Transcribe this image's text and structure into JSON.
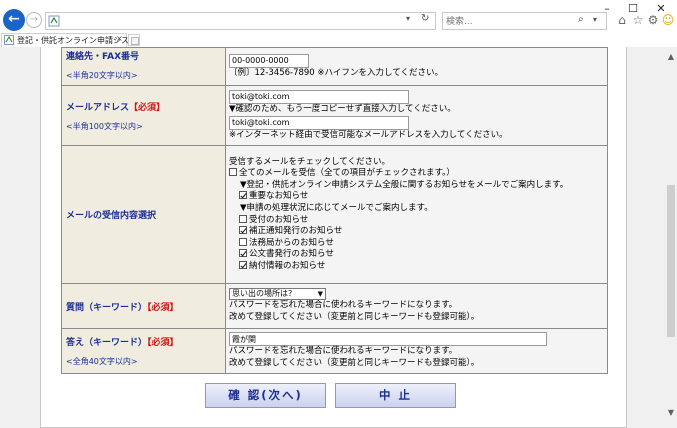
{
  "browser": {
    "window_controls": {
      "minimize": "–",
      "maximize": "☐",
      "close": "✕"
    },
    "nav": {
      "back": "←",
      "forward": "→"
    },
    "address": {
      "dropdown": "▾",
      "refresh": "↻"
    },
    "search": {
      "placeholder": "検索...",
      "icon": "⌕",
      "dropdown": "▾"
    },
    "toolbar": {
      "home": "⌂",
      "favorites": "☆",
      "settings": "⚙",
      "feedback": "☺"
    },
    "tab": {
      "label": "登記・供託オンライン申請シス...",
      "close": "×"
    }
  },
  "form": {
    "fax": {
      "label": "連絡先・FAX番号",
      "note": "<半角20文字以内>",
      "value": "00-0000-0000",
      "hint": "〔例〕12-3456-7890 ※ハイフンを入力してください。"
    },
    "email": {
      "label": "メールアドレス",
      "required": "【必須】",
      "note": "<半角100文字以内>",
      "value1": "toki@toki.com",
      "hint1": "▼確認のため、もう一度コピーせず直接入力してください。",
      "value2": "toki@toki.com",
      "hint2": "※インターネット経由で受信可能なメールアドレスを入力してください。"
    },
    "mail_select": {
      "label": "メールの受信内容選択",
      "intro": "受信するメールをチェックしてください。",
      "all": {
        "label": "全てのメールを受信（全ての項目がチェックされます。）",
        "checked": false
      },
      "group1_head": "▼登記・供託オンライン申請システム全般に関するお知らせをメールでご案内します。",
      "group1_items": [
        {
          "label": "重要なお知らせ",
          "checked": true
        }
      ],
      "group2_head": "▼申請の処理状況に応じてメールでご案内します。",
      "group2_items": [
        {
          "label": "受付のお知らせ",
          "checked": false
        },
        {
          "label": "補正通知発行のお知らせ",
          "checked": true
        },
        {
          "label": "法務局からのお知らせ",
          "checked": false
        },
        {
          "label": "公文書発行のお知らせ",
          "checked": true
        },
        {
          "label": "納付情報のお知らせ",
          "checked": true
        }
      ]
    },
    "question": {
      "label": "質問（キーワード）",
      "required": "【必須】",
      "selected": "思い出の場所は?",
      "hint1": "パスワードを忘れた場合に使われるキーワードになります。",
      "hint2": "改めて登録してください（変更前と同じキーワードも登録可能）。"
    },
    "answer": {
      "label": "答え（キーワード）",
      "required": "【必須】",
      "note": "<全角40文字以内>",
      "value": "霞が関",
      "hint1": "パスワードを忘れた場合に使われるキーワードになります。",
      "hint2": "改めて登録してください（変更前と同じキーワードも登録可能）。"
    }
  },
  "buttons": {
    "confirm": "確 認(次へ)",
    "cancel": "中 止"
  },
  "scrollbar": {
    "up": "▲",
    "down": "▼",
    "position": 0.62
  },
  "colors": {
    "label_bg": "#f0ece0",
    "value_bg": "#f4f4f4",
    "label_text": "#1c2f96",
    "required_text": "#d21414",
    "button_text": "#1c2f96"
  }
}
